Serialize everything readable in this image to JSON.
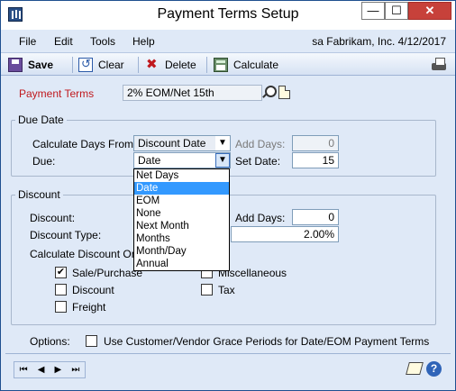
{
  "window": {
    "title": "Payment Terms Setup"
  },
  "menu": {
    "items": [
      "File",
      "Edit",
      "Tools",
      "Help"
    ],
    "company_info": "sa  Fabrikam, Inc.  4/12/2017"
  },
  "toolbar": {
    "save": "Save",
    "clear": "Clear",
    "delete": "Delete",
    "calculate": "Calculate"
  },
  "form": {
    "payment_terms_label": "Payment Terms",
    "payment_terms_value": "2% EOM/Net 15th",
    "due_date": {
      "title": "Due Date",
      "calc_days_from_label": "Calculate Days From:",
      "calc_days_from_value": "Discount Date",
      "add_days_label": "Add Days:",
      "add_days_value": "0",
      "due_label": "Due:",
      "due_value": "Date",
      "set_date_label": "Set Date:",
      "set_date_value": "15"
    },
    "discount": {
      "title": "Discount",
      "discount_label": "Discount:",
      "add_days_label": "Add Days:",
      "add_days_value": "0",
      "discount_type_label": "Discount Type:",
      "discount_pct_value": "2.00%",
      "calc_discount_on_label": "Calculate Discount On:",
      "checkboxes": [
        {
          "label": "Sale/Purchase",
          "checked": true
        },
        {
          "label": "Miscellaneous",
          "checked": false
        },
        {
          "label": "Discount",
          "checked": false
        },
        {
          "label": "Tax",
          "checked": false
        },
        {
          "label": "Freight",
          "checked": false
        }
      ]
    },
    "options_label": "Options:",
    "grace_period_label": "Use Customer/Vendor Grace Periods for Date/EOM Payment Terms"
  },
  "due_dropdown": {
    "options": [
      "Net Days",
      "Date",
      "EOM",
      "None",
      "Next Month",
      "Months",
      "Month/Day",
      "Annual"
    ],
    "selected": "Date"
  },
  "icons": {
    "nav": [
      "first-record-icon",
      "previous-record-icon",
      "next-record-icon",
      "last-record-icon"
    ]
  },
  "colors": {
    "form_background": "#dfe9f7",
    "required_label": "#c0191e",
    "close_button": "#c7413a",
    "selection": "#3399ff"
  }
}
